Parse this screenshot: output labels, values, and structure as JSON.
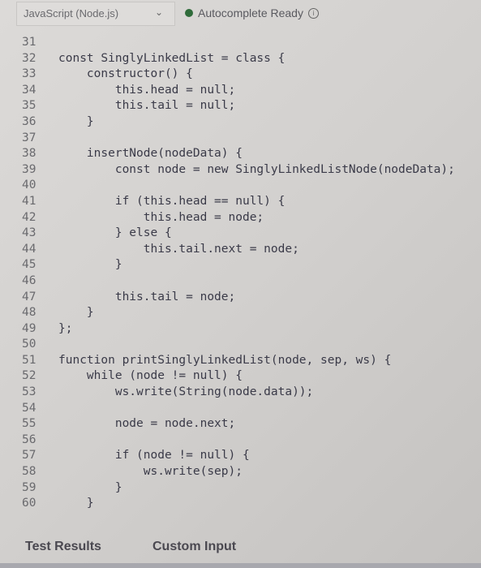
{
  "toolbar": {
    "language": "JavaScript (Node.js)",
    "language_icon": "chevron-down-icon",
    "status": "Autocomplete Ready",
    "status_color": "#2f6b3a",
    "info_icon": "info-icon"
  },
  "editor": {
    "lines": [
      {
        "n": "31",
        "code": ""
      },
      {
        "n": "32",
        "code": "const SinglyLinkedList = class {"
      },
      {
        "n": "33",
        "code": "    constructor() {"
      },
      {
        "n": "34",
        "code": "        this.head = null;"
      },
      {
        "n": "35",
        "code": "        this.tail = null;"
      },
      {
        "n": "36",
        "code": "    }"
      },
      {
        "n": "37",
        "code": ""
      },
      {
        "n": "38",
        "code": "    insertNode(nodeData) {"
      },
      {
        "n": "39",
        "code": "        const node = new SinglyLinkedListNode(nodeData);"
      },
      {
        "n": "40",
        "code": ""
      },
      {
        "n": "41",
        "code": "        if (this.head == null) {"
      },
      {
        "n": "42",
        "code": "            this.head = node;"
      },
      {
        "n": "43",
        "code": "        } else {"
      },
      {
        "n": "44",
        "code": "            this.tail.next = node;"
      },
      {
        "n": "45",
        "code": "        }"
      },
      {
        "n": "46",
        "code": ""
      },
      {
        "n": "47",
        "code": "        this.tail = node;"
      },
      {
        "n": "48",
        "code": "    }"
      },
      {
        "n": "49",
        "code": "};"
      },
      {
        "n": "50",
        "code": ""
      },
      {
        "n": "51",
        "code": "function printSinglyLinkedList(node, sep, ws) {"
      },
      {
        "n": "52",
        "code": "    while (node != null) {"
      },
      {
        "n": "53",
        "code": "        ws.write(String(node.data));"
      },
      {
        "n": "54",
        "code": ""
      },
      {
        "n": "55",
        "code": "        node = node.next;"
      },
      {
        "n": "56",
        "code": ""
      },
      {
        "n": "57",
        "code": "        if (node != null) {"
      },
      {
        "n": "58",
        "code": "            ws.write(sep);"
      },
      {
        "n": "59",
        "code": "        }"
      },
      {
        "n": "60",
        "code": "    }"
      }
    ]
  },
  "tabs": [
    {
      "label": "Test Results"
    },
    {
      "label": "Custom Input"
    }
  ]
}
